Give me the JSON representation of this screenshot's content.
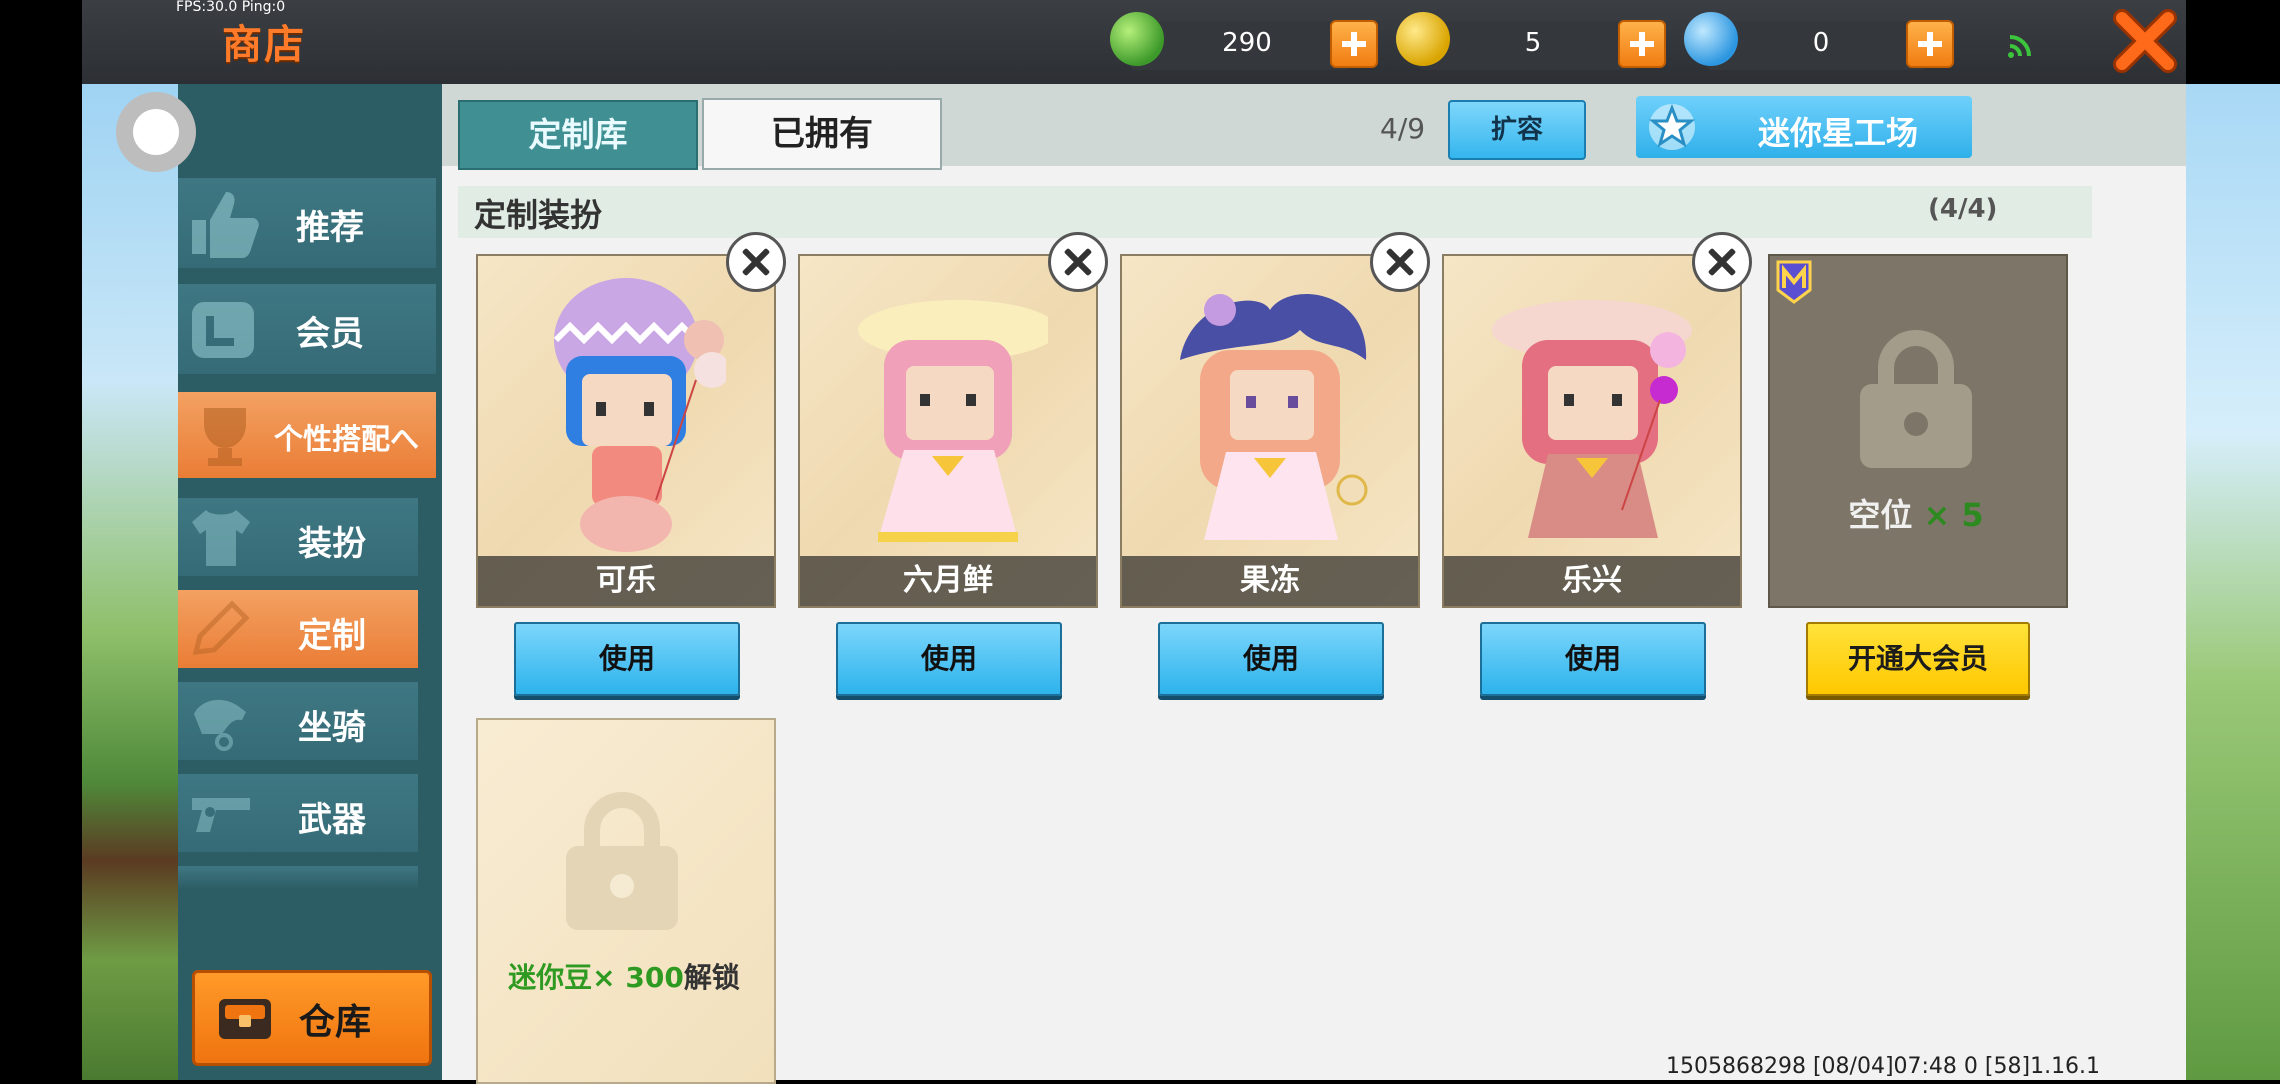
{
  "hud": {
    "fps_text": "FPS:30.0  Ping:0",
    "title": "商店",
    "currencies": [
      {
        "icon": "mini-bean-icon",
        "value": "290",
        "color": "#4caf50"
      },
      {
        "icon": "mini-coin-icon",
        "value": "5",
        "color": "#f5c400"
      },
      {
        "icon": "mini-point-icon",
        "value": "0",
        "color": "#3aa9f2"
      }
    ]
  },
  "sidebar": {
    "items": [
      {
        "label": "推荐",
        "icon": "thumbs-up-icon"
      },
      {
        "label": "会员",
        "icon": "membership-icon"
      },
      {
        "label": "个性搭配へ",
        "icon": "trophy-icon"
      },
      {
        "label": "装扮",
        "icon": "shirt-icon"
      },
      {
        "label": "定制",
        "icon": "pencil-icon"
      },
      {
        "label": "坐骑",
        "icon": "saddle-icon"
      },
      {
        "label": "武器",
        "icon": "gun-icon"
      }
    ],
    "warehouse_label": "仓库"
  },
  "tabs": {
    "custom_library": "定制库",
    "owned": "已拥有"
  },
  "toolbar": {
    "capacity": "4/9",
    "expand_label": "扩容",
    "workshop_label": "迷你星工场"
  },
  "section": {
    "title": "定制装扮",
    "count": "(4/4)"
  },
  "outfits": [
    {
      "name": "可乐",
      "use_label": "使用"
    },
    {
      "name": "六月鲜",
      "use_label": "使用"
    },
    {
      "name": "果冻",
      "use_label": "使用"
    },
    {
      "name": "乐兴",
      "use_label": "使用"
    }
  ],
  "locked_slot": {
    "label": "空位",
    "multiplier": "× 5",
    "vip_button": "开通大会员"
  },
  "unlock_slot": {
    "currency": "迷你豆",
    "amount": "× 300",
    "action": "解锁"
  },
  "footer": {
    "info": "1505868298  [08/04]07:48 0 [58]1.16.1"
  }
}
